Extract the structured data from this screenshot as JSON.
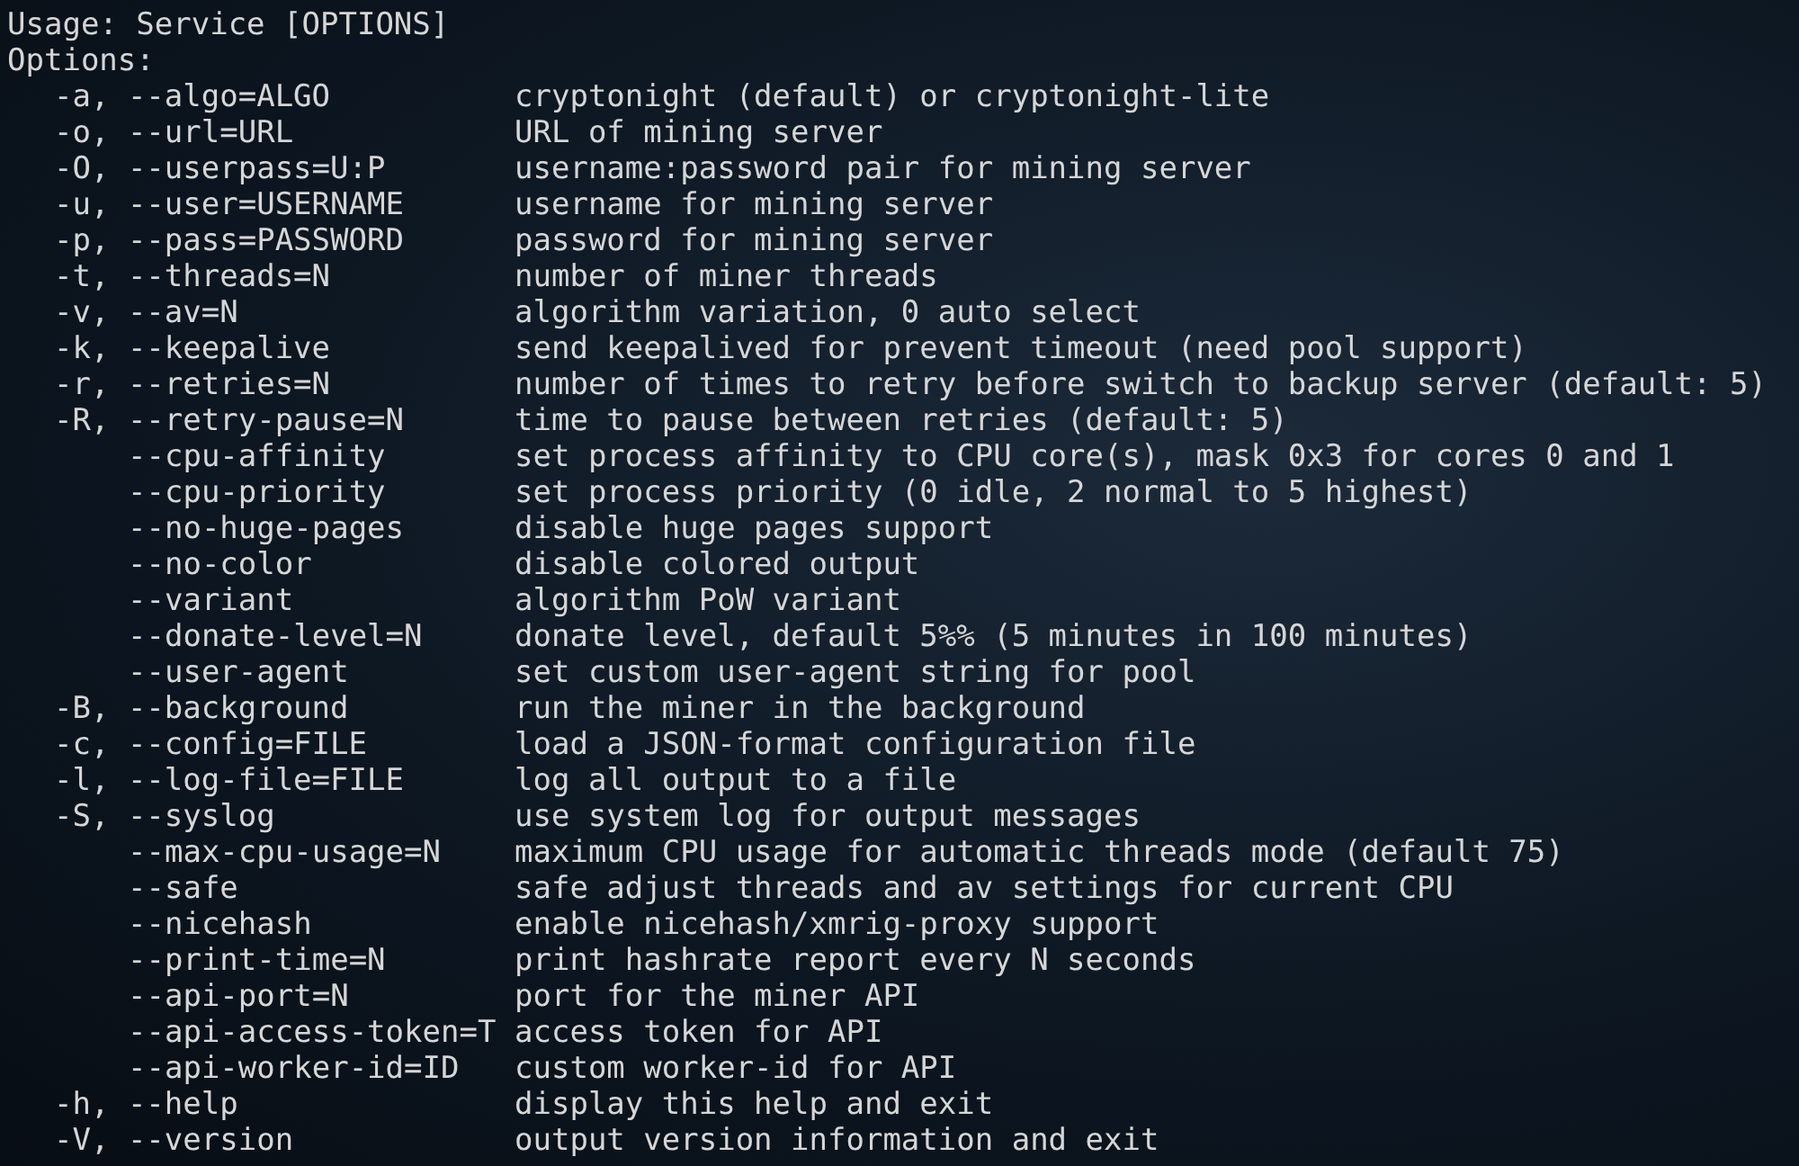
{
  "usage": "Usage: Service [OPTIONS]",
  "options_heading": "Options:",
  "options": [
    {
      "kind": "short",
      "flag": "-a, --algo=ALGO",
      "description": "cryptonight (default) or cryptonight-lite"
    },
    {
      "kind": "short",
      "flag": "-o, --url=URL",
      "description": "URL of mining server"
    },
    {
      "kind": "short",
      "flag": "-O, --userpass=U:P",
      "description": "username:password pair for mining server"
    },
    {
      "kind": "short",
      "flag": "-u, --user=USERNAME",
      "description": "username for mining server"
    },
    {
      "kind": "short",
      "flag": "-p, --pass=PASSWORD",
      "description": "password for mining server"
    },
    {
      "kind": "short",
      "flag": "-t, --threads=N",
      "description": "number of miner threads"
    },
    {
      "kind": "short",
      "flag": "-v, --av=N",
      "description": "algorithm variation, 0 auto select"
    },
    {
      "kind": "short",
      "flag": "-k, --keepalive",
      "description": "send keepalived for prevent timeout (need pool support)"
    },
    {
      "kind": "short",
      "flag": "-r, --retries=N",
      "description": "number of times to retry before switch to backup server (default: 5)"
    },
    {
      "kind": "short",
      "flag": "-R, --retry-pause=N",
      "description": "time to pause between retries (default: 5)"
    },
    {
      "kind": "long",
      "flag": "--cpu-affinity",
      "description": "set process affinity to CPU core(s), mask 0x3 for cores 0 and 1"
    },
    {
      "kind": "long",
      "flag": "--cpu-priority",
      "description": "set process priority (0 idle, 2 normal to 5 highest)"
    },
    {
      "kind": "long",
      "flag": "--no-huge-pages",
      "description": "disable huge pages support"
    },
    {
      "kind": "long",
      "flag": "--no-color",
      "description": "disable colored output"
    },
    {
      "kind": "long",
      "flag": "--variant",
      "description": "algorithm PoW variant"
    },
    {
      "kind": "long",
      "flag": "--donate-level=N",
      "description": "donate level, default 5%% (5 minutes in 100 minutes)"
    },
    {
      "kind": "long",
      "flag": "--user-agent",
      "description": "set custom user-agent string for pool"
    },
    {
      "kind": "short",
      "flag": "-B, --background",
      "description": "run the miner in the background"
    },
    {
      "kind": "short",
      "flag": "-c, --config=FILE",
      "description": "load a JSON-format configuration file"
    },
    {
      "kind": "short",
      "flag": "-l, --log-file=FILE",
      "description": "log all output to a file"
    },
    {
      "kind": "short",
      "flag": "-S, --syslog",
      "description": "use system log for output messages"
    },
    {
      "kind": "long",
      "flag": "--max-cpu-usage=N",
      "description": "maximum CPU usage for automatic threads mode (default 75)"
    },
    {
      "kind": "long",
      "flag": "--safe",
      "description": "safe adjust threads and av settings for current CPU"
    },
    {
      "kind": "long",
      "flag": "--nicehash",
      "description": "enable nicehash/xmrig-proxy support"
    },
    {
      "kind": "long",
      "flag": "--print-time=N",
      "description": "print hashrate report every N seconds"
    },
    {
      "kind": "long",
      "flag": "--api-port=N",
      "description": "port for the miner API"
    },
    {
      "kind": "long",
      "flag": "--api-access-token=T",
      "description": "access token for API"
    },
    {
      "kind": "long",
      "flag": "--api-worker-id=ID",
      "description": "custom worker-id for API"
    },
    {
      "kind": "short",
      "flag": "-h, --help",
      "description": "display this help and exit"
    },
    {
      "kind": "short",
      "flag": "-V, --version",
      "description": "output version information and exit"
    }
  ]
}
